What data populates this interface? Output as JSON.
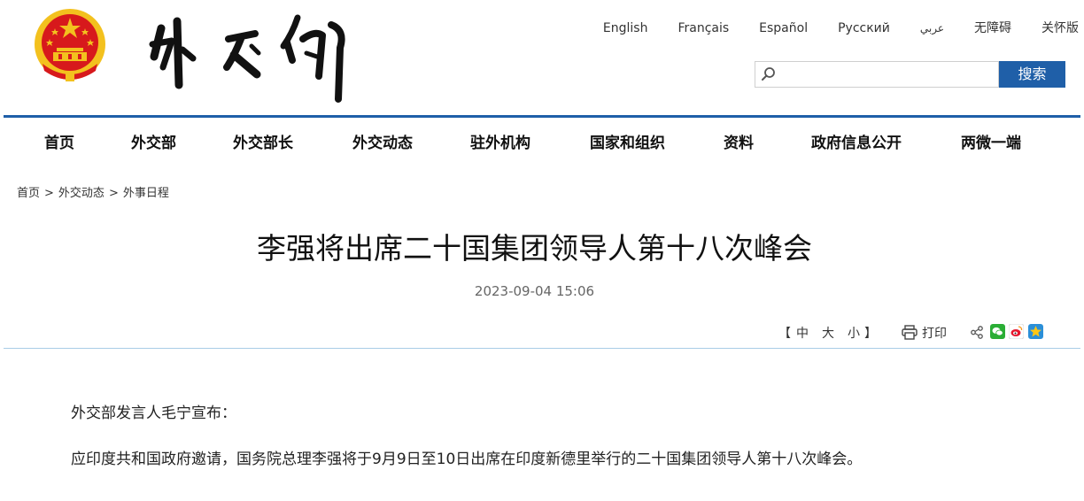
{
  "colors": {
    "accent": "#1f5fa8",
    "divider": "#a9cce6",
    "emblem_red": "#d7191c",
    "emblem_gold": "#f3c11e"
  },
  "header": {
    "logo_text": "外交部",
    "languages": [
      "English",
      "Français",
      "Español",
      "Русский",
      "عربي",
      "无障碍",
      "关怀版"
    ]
  },
  "search": {
    "placeholder": "",
    "value": "",
    "button_label": "搜索"
  },
  "nav": {
    "items": [
      "首页",
      "外交部",
      "外交部长",
      "外交动态",
      "驻外机构",
      "国家和组织",
      "资料",
      "政府信息公开",
      "两微一端"
    ]
  },
  "breadcrumb": {
    "items": [
      "首页",
      "外交动态",
      "外事日程"
    ],
    "separator": ">"
  },
  "article": {
    "title": "李强将出席二十国集团领导人第十八次峰会",
    "date": "2023-09-04 15:06",
    "font_size": {
      "open": "【",
      "large": "中",
      "medium": "大",
      "small": "小",
      "close": "】"
    },
    "print_label": "打印",
    "share_icons": [
      "share-icon",
      "wechat-icon",
      "weibo-icon",
      "qzone-icon"
    ],
    "paragraphs": [
      "外交部发言人毛宁宣布：",
      "应印度共和国政府邀请，国务院总理李强将于9月9日至10日出席在印度新德里举行的二十国集团领导人第十八次峰会。"
    ]
  }
}
